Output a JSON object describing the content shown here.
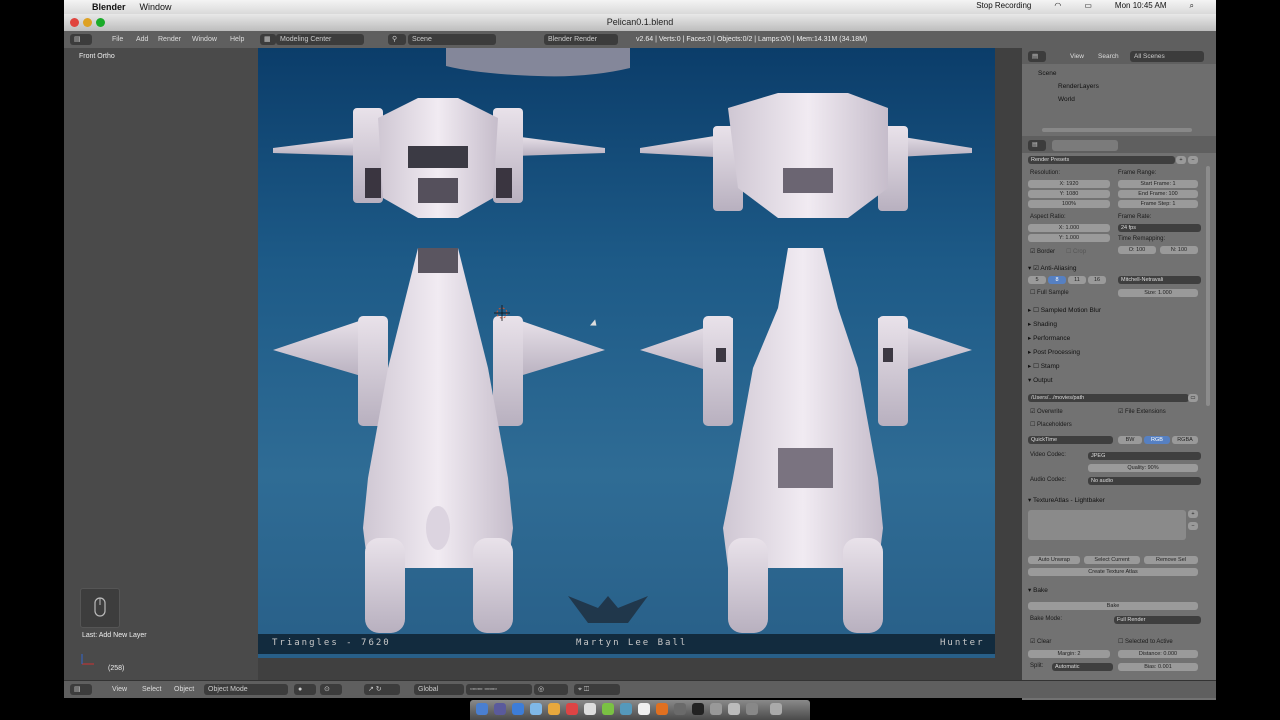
{
  "mac_menubar": {
    "app": "Blender",
    "menu": "Window",
    "stop_recording": "Stop Recording",
    "time": "Mon 10:45 AM"
  },
  "window": {
    "title": "Pelican0.1.blend"
  },
  "header": {
    "menus": [
      "File",
      "Add",
      "Render",
      "Window",
      "Help"
    ],
    "layout": "Modeling Center",
    "scene": "Scene",
    "engine": "Blender Render",
    "stats": "v2.64 | Verts:0 | Faces:0 | Objects:0/2 | Lamps:0/0 | Mem:14.31M (34.18M)"
  },
  "toolshelf": {
    "view_label": "Front Ortho",
    "last_op": "Last: Add New Layer",
    "frame": "(258)"
  },
  "viewport_overlay": {
    "triangles": "Triangles - 7620",
    "author": "Martyn Lee Ball",
    "name": "Hunter"
  },
  "outliner": {
    "menus": [
      "View",
      "Search"
    ],
    "filter": "All Scenes",
    "items": [
      "Scene",
      "RenderLayers",
      "World"
    ]
  },
  "properties": {
    "presets": "Render Presets",
    "resolution_label": "Resolution:",
    "res_x": "X: 1920",
    "res_y": "Y: 1080",
    "res_pct": "100%",
    "frame_range_label": "Frame Range:",
    "start": "Start Frame: 1",
    "end": "End Frame: 100",
    "step": "Frame Step: 1",
    "aspect_label": "Aspect Ratio:",
    "asp_x": "X: 1.000",
    "asp_y": "Y: 1.000",
    "frame_rate_label": "Frame Rate:",
    "fps": "24 fps",
    "time_remap_label": "Time Remapping:",
    "remap_old": "O: 100",
    "remap_new": "N: 100",
    "border": "Border",
    "crop": "Crop",
    "anti_aliasing": "Anti-Aliasing",
    "aa_samples": [
      "5",
      "8",
      "11",
      "16"
    ],
    "filter": "Mitchell-Netravali",
    "full_sample": "Full Sample",
    "size": "Size: 1.000",
    "sections": [
      "Sampled Motion Blur",
      "Shading",
      "Performance",
      "Post Processing",
      "Stamp",
      "Output"
    ],
    "output_path": "/Users/.../movies/path",
    "overwrite": "Overwrite",
    "file_ext": "File Extensions",
    "placeholders": "Placeholders",
    "format": "QuickTime",
    "color_modes": [
      "BW",
      "RGB",
      "RGBA"
    ],
    "video_codec_label": "Video Codec:",
    "video_codec": "JPEG",
    "quality": "Quality: 90%",
    "audio_codec_label": "Audio Codec:",
    "audio_codec": "No audio",
    "texture_atlas": "TextureAtlas - Lightbaker",
    "auto_unwrap": "Auto Unwrap",
    "select_current": "Select Current",
    "remove_sel": "Remove Sel",
    "create_atlas": "Create Texture Atlas",
    "bake_section": "Bake",
    "bake_button": "Bake",
    "bake_mode_label": "Bake Mode:",
    "bake_mode": "Full Render",
    "clear": "Clear",
    "selected_to_active": "Selected to Active",
    "margin": "Margin: 2",
    "distance": "Distance: 0.000",
    "split_label": "Split:",
    "split": "Automatic",
    "bias": "Bias: 0.001"
  },
  "footer": {
    "menus": [
      "View",
      "Select",
      "Object"
    ],
    "mode": "Object Mode",
    "orientation": "Global"
  }
}
